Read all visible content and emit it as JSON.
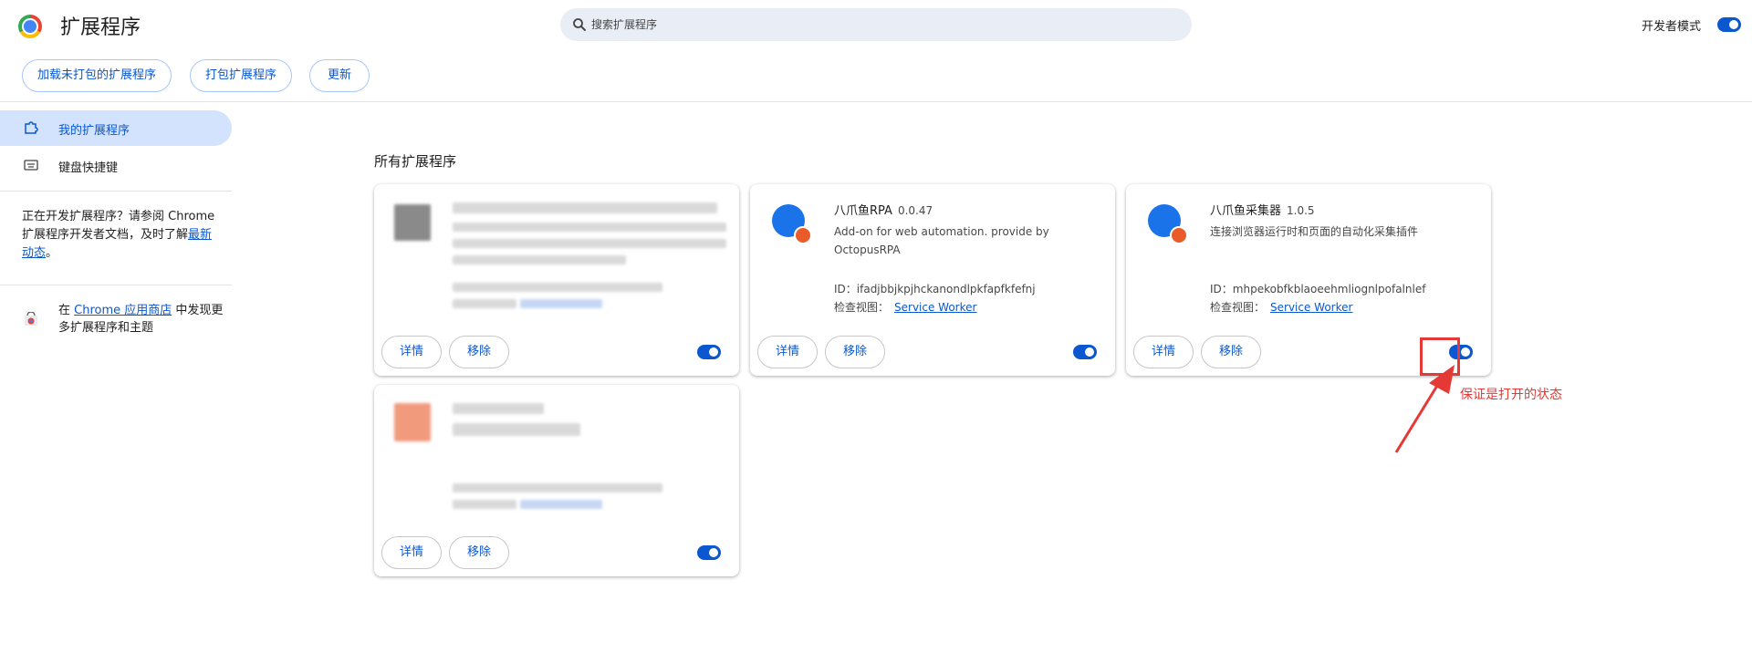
{
  "header": {
    "title": "扩展程序",
    "search_placeholder": "搜索扩展程序",
    "dev_mode_label": "开发者模式",
    "dev_mode_on": true
  },
  "toolbar": {
    "load_unpacked": "加载未打包的扩展程序",
    "pack": "打包扩展程序",
    "update": "更新"
  },
  "sidebar": {
    "items": [
      {
        "label": "我的扩展程序",
        "icon": "puzzle-icon",
        "selected": true
      },
      {
        "label": "键盘快捷键",
        "icon": "keyboard-icon",
        "selected": false
      }
    ],
    "dev_note_1": "正在开发扩展程序？请参阅 Chrome 扩展程序开发者文档，及时了解",
    "dev_note_link": "最新动态",
    "dev_note_end": "。",
    "store_prefix": "在 ",
    "store_link": "Chrome 应用商店",
    "store_suffix": " 中发现更多扩展程序和主题"
  },
  "main": {
    "section_title": "所有扩展程序",
    "details_label": "详情",
    "remove_label": "移除",
    "extensions": [
      {
        "name": "",
        "blurred": true,
        "enabled": true
      },
      {
        "name": "八爪鱼RPA",
        "version": "0.0.47",
        "description": "Add-on for web automation. provide by OctopusRPA",
        "id_label": "ID：",
        "id": "ifadjbbjkpjhckanondlpkfapfkfefnj",
        "view_label": "检查视图：",
        "view_link": "Service Worker",
        "enabled": true
      },
      {
        "name": "八爪鱼采集器",
        "version": "1.0.5",
        "description": "连接浏览器运行时和页面的自动化采集插件",
        "id_label": "ID：",
        "id": "mhpekobfkblaoeehmliognlpofalnlef",
        "view_label": "检查视图：",
        "view_link": "Service Worker",
        "enabled": true
      },
      {
        "name": "",
        "blurred": true,
        "enabled": true
      }
    ]
  },
  "annotation": {
    "text": "保证是打开的状态",
    "color": "#e53935"
  },
  "colors": {
    "accent": "#0b57d0",
    "selected_nav_bg": "#d3e3fd",
    "search_bg": "#e9eef6"
  }
}
